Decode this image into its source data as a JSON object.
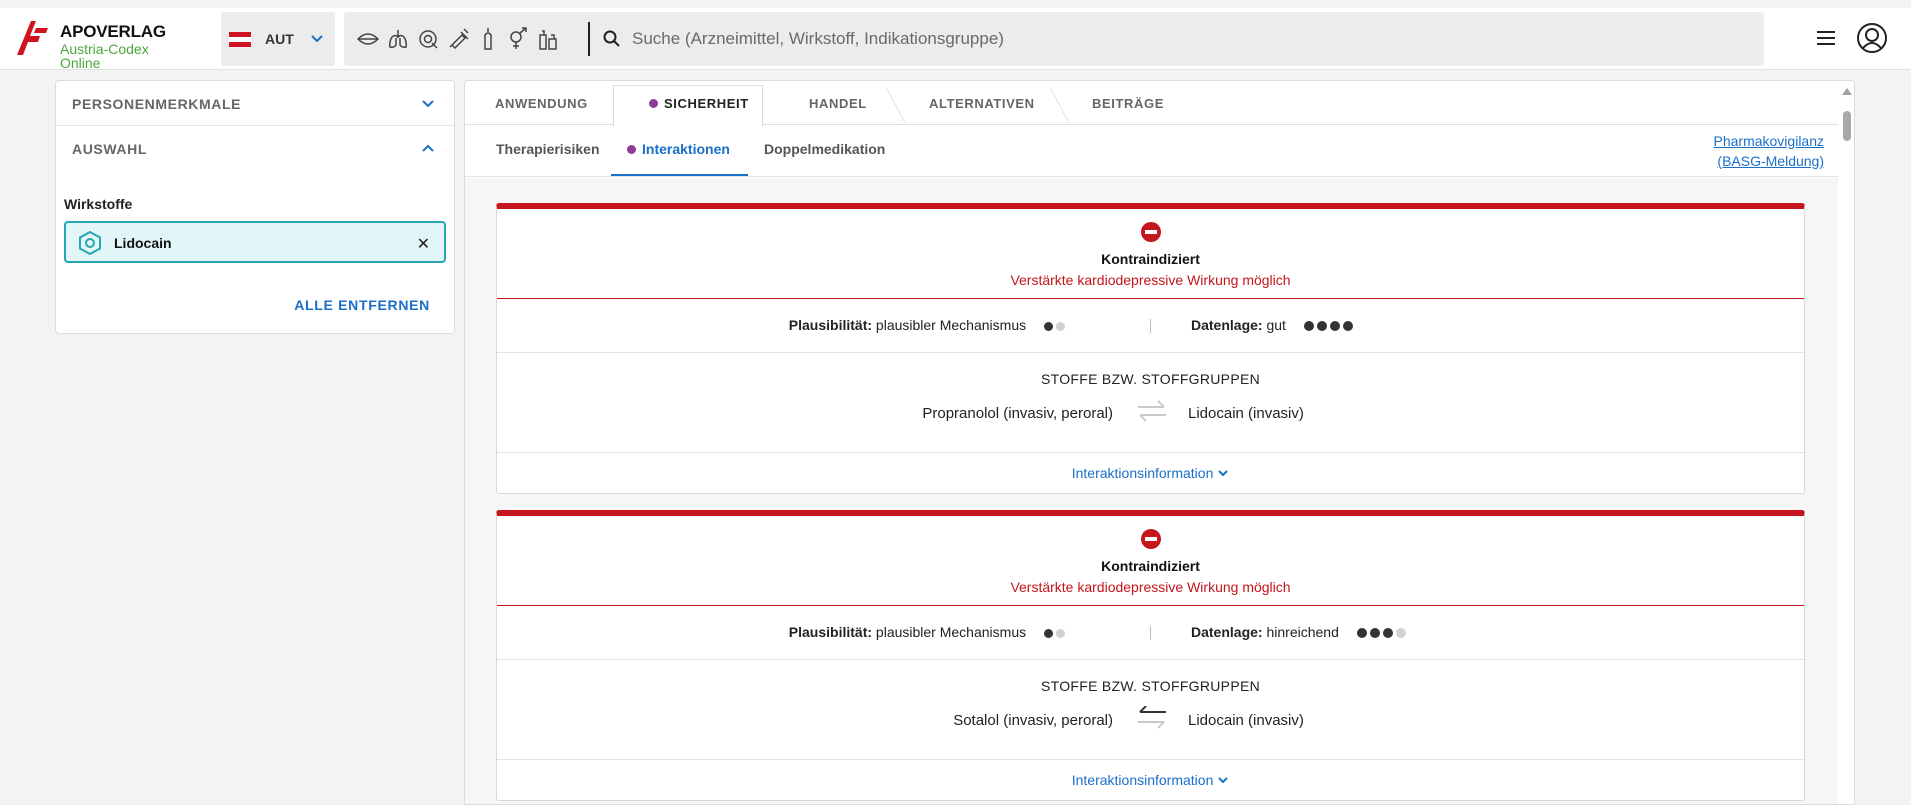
{
  "header": {
    "brand": "APOVERLAG",
    "subtitle_line1": "Austria-Codex",
    "subtitle_line2": "Online",
    "country_code": "AUT",
    "search_placeholder": "Suche (Arzneimittel, Wirkstoff, Indikationsgruppe)",
    "category_icons": [
      "mouth-icon",
      "lungs-icon",
      "eye-icon",
      "syringe-icon",
      "ampoule-icon",
      "gender-icon",
      "bottles-icon"
    ],
    "accent_color": "#1a6fc9",
    "brand_color": "#d0141f",
    "green": "#4aa63a"
  },
  "sidebar": {
    "section1": "PERSONENMERKMALE",
    "section2": "AUSWAHL",
    "wirkstoffe_label": "Wirkstoffe",
    "chip": "Lidocain",
    "remove_all": "ALLE ENTFERNEN"
  },
  "tabs": {
    "items": [
      "ANWENDUNG",
      "SICHERHEIT",
      "HANDEL",
      "ALTERNATIVEN",
      "BEITRÄGE"
    ],
    "active": "SICHERHEIT"
  },
  "subtabs": {
    "items": [
      "Therapierisiken",
      "Interaktionen",
      "Doppelmedikation"
    ],
    "active": "Interaktionen",
    "pharmako_line1": "Pharmakovigilanz",
    "pharmako_line2": "(BASG-Meldung)"
  },
  "interactions": [
    {
      "severity": "Kontraindiziert",
      "effect": "Verstärkte kardiodepressive Wirkung möglich",
      "plausibility_label": "Plausibilität:",
      "plausibility_value": "plausibler Mechanismus",
      "plausibility_dots": "1 of 2",
      "data_label": "Datenlage:",
      "data_value": "gut",
      "data_dots": "4 of 4",
      "substances_title": "STOFFE BZW. STOFFGRUPPEN",
      "substance_a": "Propranolol (invasiv, peroral)",
      "substance_b": "Lidocain (invasiv)",
      "info_link": "Interaktionsinformation"
    },
    {
      "severity": "Kontraindiziert",
      "effect": "Verstärkte kardiodepressive Wirkung möglich",
      "plausibility_label": "Plausibilität:",
      "plausibility_value": "plausibler Mechanismus",
      "plausibility_dots": "1 of 2",
      "data_label": "Datenlage:",
      "data_value": "hinreichend",
      "data_dots": "3 of 4",
      "substances_title": "STOFFE BZW. STOFFGRUPPEN",
      "substance_a": "Sotalol (invasiv, peroral)",
      "substance_b": "Lidocain (invasiv)",
      "info_link": "Interaktionsinformation"
    }
  ]
}
